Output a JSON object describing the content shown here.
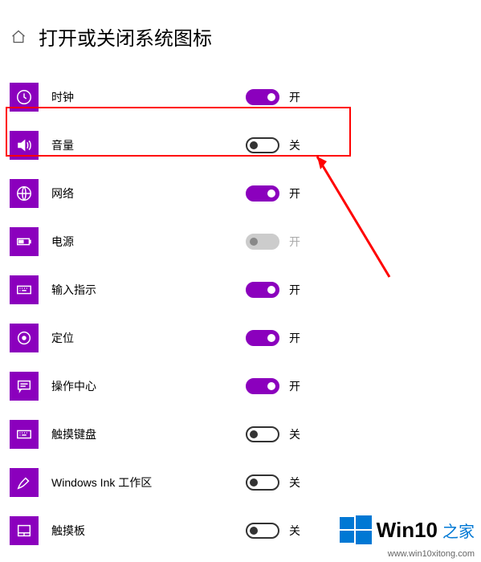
{
  "header": {
    "title": "打开或关闭系统图标"
  },
  "labels": {
    "on": "开",
    "off": "关"
  },
  "rows": [
    {
      "key": "clock",
      "icon": "clock",
      "label": "时钟",
      "state": "on"
    },
    {
      "key": "volume",
      "icon": "volume",
      "label": "音量",
      "state": "off"
    },
    {
      "key": "network",
      "icon": "globe",
      "label": "网络",
      "state": "on"
    },
    {
      "key": "power",
      "icon": "battery",
      "label": "电源",
      "state": "disabled",
      "stateLabel": "开"
    },
    {
      "key": "ime",
      "icon": "keyboard",
      "label": "输入指示",
      "state": "on"
    },
    {
      "key": "location",
      "icon": "target",
      "label": "定位",
      "state": "on"
    },
    {
      "key": "action",
      "icon": "message",
      "label": "操作中心",
      "state": "on"
    },
    {
      "key": "touchkb",
      "icon": "keyboard",
      "label": "触摸键盘",
      "state": "off"
    },
    {
      "key": "ink",
      "icon": "pen",
      "label": "Windows Ink 工作区",
      "state": "off"
    },
    {
      "key": "touchpad",
      "icon": "touchpad",
      "label": "触摸板",
      "state": "off"
    }
  ],
  "annotation": {
    "highlight_row": "volume"
  },
  "watermark": {
    "text1": "Win10",
    "text2": "之家",
    "url": "www.win10xitong.com"
  }
}
